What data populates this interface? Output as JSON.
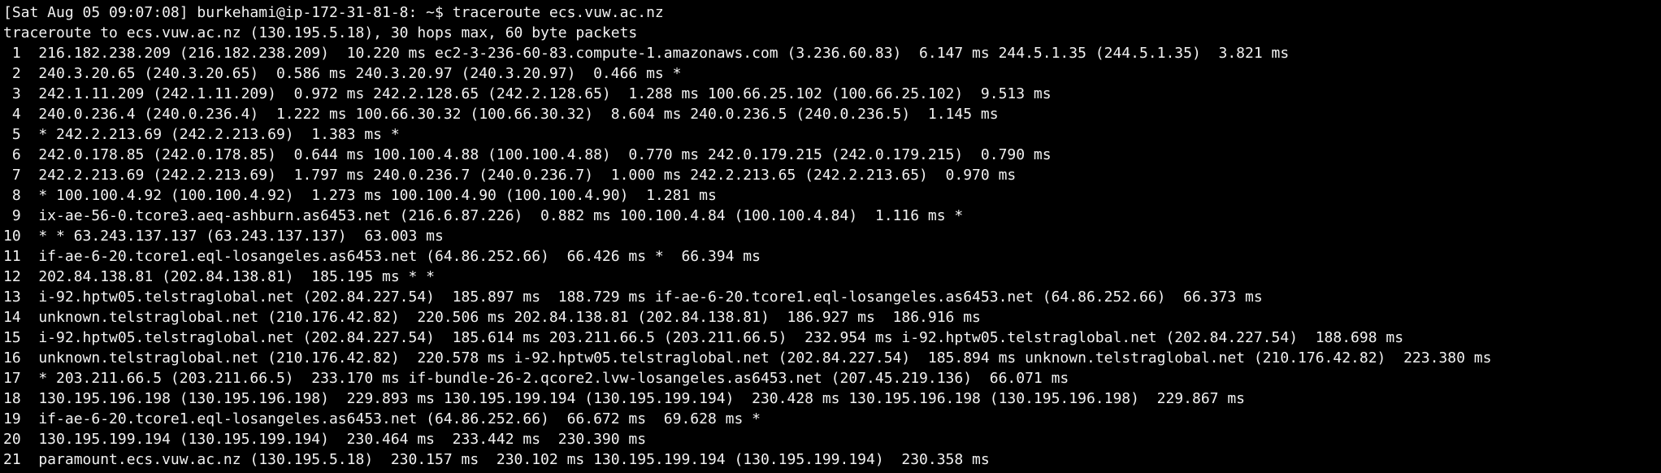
{
  "terminal": {
    "prompt": "[Sat Aug 05 09:07:08] burkehami@ip-172-31-81-8: ~$ ",
    "command": "traceroute ecs.vuw.ac.nz",
    "header": "traceroute to ecs.vuw.ac.nz (130.195.5.18), 30 hops max, 60 byte packets",
    "hops": [
      " 1  216.182.238.209 (216.182.238.209)  10.220 ms ec2-3-236-60-83.compute-1.amazonaws.com (3.236.60.83)  6.147 ms 244.5.1.35 (244.5.1.35)  3.821 ms",
      " 2  240.3.20.65 (240.3.20.65)  0.586 ms 240.3.20.97 (240.3.20.97)  0.466 ms *",
      " 3  242.1.11.209 (242.1.11.209)  0.972 ms 242.2.128.65 (242.2.128.65)  1.288 ms 100.66.25.102 (100.66.25.102)  9.513 ms",
      " 4  240.0.236.4 (240.0.236.4)  1.222 ms 100.66.30.32 (100.66.30.32)  8.604 ms 240.0.236.5 (240.0.236.5)  1.145 ms",
      " 5  * 242.2.213.69 (242.2.213.69)  1.383 ms *",
      " 6  242.0.178.85 (242.0.178.85)  0.644 ms 100.100.4.88 (100.100.4.88)  0.770 ms 242.0.179.215 (242.0.179.215)  0.790 ms",
      " 7  242.2.213.69 (242.2.213.69)  1.797 ms 240.0.236.7 (240.0.236.7)  1.000 ms 242.2.213.65 (242.2.213.65)  0.970 ms",
      " 8  * 100.100.4.92 (100.100.4.92)  1.273 ms 100.100.4.90 (100.100.4.90)  1.281 ms",
      " 9  ix-ae-56-0.tcore3.aeq-ashburn.as6453.net (216.6.87.226)  0.882 ms 100.100.4.84 (100.100.4.84)  1.116 ms *",
      "10  * * 63.243.137.137 (63.243.137.137)  63.003 ms",
      "11  if-ae-6-20.tcore1.eql-losangeles.as6453.net (64.86.252.66)  66.426 ms *  66.394 ms",
      "12  202.84.138.81 (202.84.138.81)  185.195 ms * *",
      "13  i-92.hptw05.telstraglobal.net (202.84.227.54)  185.897 ms  188.729 ms if-ae-6-20.tcore1.eql-losangeles.as6453.net (64.86.252.66)  66.373 ms",
      "14  unknown.telstraglobal.net (210.176.42.82)  220.506 ms 202.84.138.81 (202.84.138.81)  186.927 ms  186.916 ms",
      "15  i-92.hptw05.telstraglobal.net (202.84.227.54)  185.614 ms 203.211.66.5 (203.211.66.5)  232.954 ms i-92.hptw05.telstraglobal.net (202.84.227.54)  188.698 ms",
      "16  unknown.telstraglobal.net (210.176.42.82)  220.578 ms i-92.hptw05.telstraglobal.net (202.84.227.54)  185.894 ms unknown.telstraglobal.net (210.176.42.82)  223.380 ms",
      "17  * 203.211.66.5 (203.211.66.5)  233.170 ms if-bundle-26-2.qcore2.lvw-losangeles.as6453.net (207.45.219.136)  66.071 ms",
      "18  130.195.196.198 (130.195.196.198)  229.893 ms 130.195.199.194 (130.195.199.194)  230.428 ms 130.195.196.198 (130.195.196.198)  229.867 ms",
      "19  if-ae-6-20.tcore1.eql-losangeles.as6453.net (64.86.252.66)  66.672 ms  69.628 ms *",
      "20  130.195.199.194 (130.195.199.194)  230.464 ms  233.442 ms  230.390 ms",
      "21  paramount.ecs.vuw.ac.nz (130.195.5.18)  230.157 ms  230.102 ms 130.195.199.194 (130.195.199.194)  230.358 ms"
    ]
  }
}
